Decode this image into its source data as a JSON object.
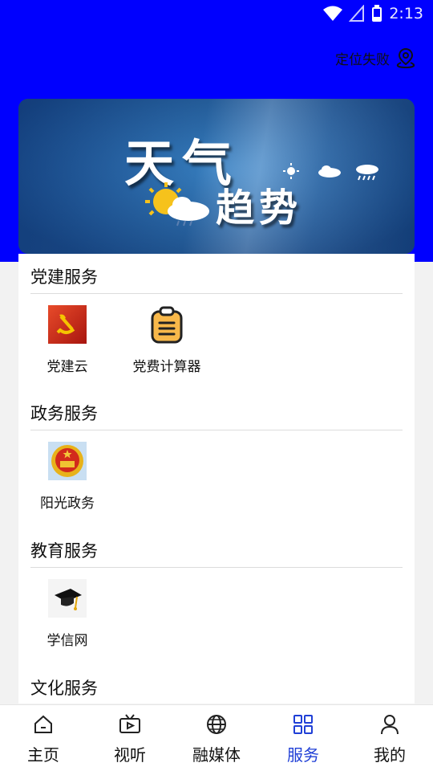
{
  "status_bar": {
    "time": "2:13"
  },
  "header": {
    "location_text": "定位失败"
  },
  "banner": {
    "line1": "天气",
    "line2": "趋势"
  },
  "sections": [
    {
      "title": "党建服务",
      "items": [
        {
          "label": "党建云",
          "icon": "party-flag-icon"
        },
        {
          "label": "党费计算器",
          "icon": "clipboard-icon"
        }
      ]
    },
    {
      "title": "政务服务",
      "items": [
        {
          "label": "阳光政务",
          "icon": "national-emblem-icon"
        }
      ]
    },
    {
      "title": "教育服务",
      "items": [
        {
          "label": "学信网",
          "icon": "graduation-cap-icon"
        }
      ]
    },
    {
      "title": "文化服务",
      "items": []
    }
  ],
  "tabs": [
    {
      "label": "主页",
      "icon": "home-icon"
    },
    {
      "label": "视听",
      "icon": "tv-icon"
    },
    {
      "label": "融媒体",
      "icon": "globe-icon"
    },
    {
      "label": "服务",
      "icon": "grid-icon",
      "active": true
    },
    {
      "label": "我的",
      "icon": "person-icon"
    }
  ],
  "colors": {
    "header_bg": "#0000fe",
    "active_tab": "#1f3fd6"
  }
}
